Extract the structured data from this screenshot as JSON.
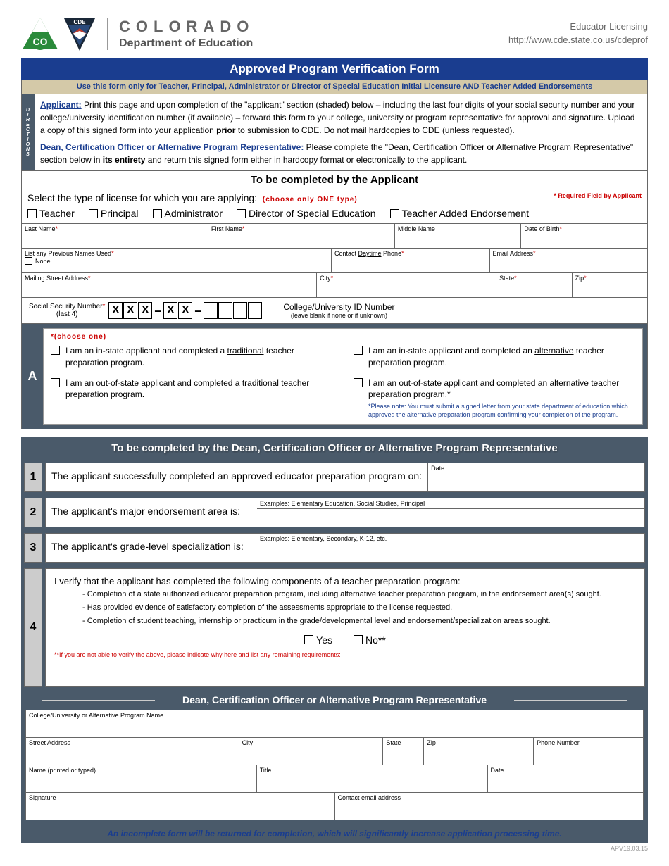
{
  "header": {
    "org_title": "COLORADO",
    "org_sub": "Department of Education",
    "right1": "Educator Licensing",
    "right2": "http://www.cde.state.co.us/cdeprof",
    "logo_co": "CO",
    "logo_cde": "CDE"
  },
  "title": "Approved Program Verification Form",
  "tan_bar": "Use this form only for Teacher, Principal, Administrator or Director of Special Education Initial Licensure AND Teacher Added Endorsements",
  "directions_label": "DIRECTIONS",
  "dir": {
    "applicant_link": "Applicant:",
    "applicant_text1": " Print this page and upon completion of the \"applicant\" section (shaded) below – including the last four digits of your social security number and your college/university identification number (if available) – forward this form to your college, university or program representative for approval and signature. Upload a copy of this signed form into your application ",
    "prior": "prior",
    "applicant_text2": " to submission to CDE. Do not mail hardcopies to CDE (unless requested).",
    "dean_link": "Dean, Certification Officer or Alternative Program Representative:",
    "dean_text1": " Please complete the \"Dean, Certification Officer or Alternative Program Representative\" section below in ",
    "entirety": "its entirety",
    "dean_text2": " and return this signed form either in hardcopy format or electronically to the applicant."
  },
  "applicant_heading": "To be completed by the Applicant",
  "type_select": "Select the type of license for which you are applying:",
  "type_hint": "(choose only ONE type)",
  "req_note": "* Required Field by Applicant",
  "types": {
    "teacher": "Teacher",
    "principal": "Principal",
    "admin": "Administrator",
    "director": "Director of Special Education",
    "added": "Teacher Added Endorsement"
  },
  "fields": {
    "last_name": "Last Name",
    "first_name": "First Name",
    "middle_name": "Middle Name",
    "dob": "Date of Birth",
    "prev_names": "List any Previous Names Used",
    "none": "None",
    "daytime_phone_pre": "Contact ",
    "daytime_phone_u": "Daytime",
    "daytime_phone_post": " Phone",
    "email": "Email Address",
    "mailing": "Mailing Street Address",
    "city": "City",
    "state": "State",
    "zip": "Zip",
    "ssn": "Social Security Number",
    "ssn_last4": "(last 4)",
    "college_id": "College/University ID Number",
    "college_id_sub": "(leave blank if none or if unknown)"
  },
  "ssn_mask": [
    "X",
    "X",
    "X",
    "–",
    "X",
    "X",
    "–",
    "",
    "",
    "",
    ""
  ],
  "section_a": {
    "label": "A",
    "choose_one": "*(choose one)",
    "opt1_pre": "I am an in-state applicant and completed a ",
    "opt1_u": "traditional",
    "opt1_post": " teacher preparation program.",
    "opt2_pre": "I am an out-of-state applicant and completed a ",
    "opt2_u": "traditional",
    "opt2_post": " teacher preparation program.",
    "opt3_pre": "I am an in-state applicant and completed an ",
    "opt3_u": "alternative",
    "opt3_post": " teacher preparation program.",
    "opt4_pre": "I am an out-of-state applicant and completed an ",
    "opt4_u": "alternative",
    "opt4_post": " teacher preparation program.*",
    "please_note": "*Please note: You must submit a signed letter from your state department of education which approved the alternative preparation program confirming your completion of the program."
  },
  "dean_heading": "To be completed by the Dean, Certification Officer or Alternative Program Representative",
  "rows": {
    "r1": "The applicant successfully completed an approved educator preparation program on:",
    "r1_date": "Date",
    "r2": "The applicant's major endorsement area is:",
    "r2_ex": "Examples: Elementary Education, Social Studies, Principal",
    "r3": "The applicant's grade-level specialization is:",
    "r3_ex": "Examples: Elementary, Secondary, K-12, etc.",
    "r4_intro": "I verify that the applicant has completed the following components of a teacher preparation program:",
    "r4_li1": "- Completion of a state authorized educator preparation program, including alternative teacher preparation program, in the endorsement area(s) sought.",
    "r4_li2": "- Has provided evidence of satisfactory completion of the assessments appropriate to the license requested.",
    "r4_li3": "- Completion of student teaching, internship or practicum in the grade/developmental level and endorsement/specialization areas sought.",
    "yes": "Yes",
    "no": "No**",
    "r4_note": "**If you are not able to verify the above, please indicate why here and list any remaining requirements:"
  },
  "sig_heading": "Dean, Certification Officer or Alternative Program Representative",
  "sig": {
    "college": "College/University or Alternative Program Name",
    "street": "Street Address",
    "city": "City",
    "state": "State",
    "zip": "Zip",
    "phone": "Phone Number",
    "name": "Name (printed or typed)",
    "title": "Title",
    "date": "Date",
    "signature": "Signature",
    "email": "Contact email address"
  },
  "footer": "An incomplete form will be returned for completion, which will significantly increase application processing time.",
  "version": "APV19.03.15"
}
